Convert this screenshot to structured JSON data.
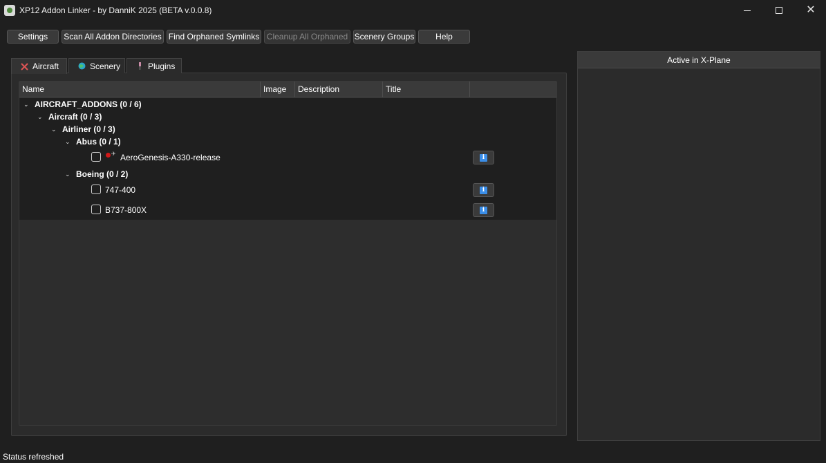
{
  "window": {
    "title": "XP12 Addon Linker - by DanniK 2025 (BETA v.0.0.8)",
    "minimize_icon": "minimize-icon",
    "maximize_icon": "maximize-icon",
    "close_icon": "close-icon",
    "close_glyph": "✕"
  },
  "toolbar": {
    "settings": "Settings",
    "scan": "Scan All Addon Directories",
    "find_orphaned": "Find Orphaned Symlinks",
    "cleanup_orphaned": "Cleanup All Orphaned",
    "scenery_groups": "Scenery Groups",
    "help": "Help"
  },
  "tabs": [
    {
      "label": "Aircraft",
      "icon": "aircraft-icon"
    },
    {
      "label": "Scenery",
      "icon": "globe-icon"
    },
    {
      "label": "Plugins",
      "icon": "plug-icon"
    }
  ],
  "tree": {
    "columns": [
      "Name",
      "Image",
      "Description",
      "Title",
      ""
    ],
    "chevron": "⌄",
    "root": "AIRCRAFT_ADDONS (0 / 6)",
    "aircraft": "Aircraft (0 / 3)",
    "airliner": "Airliner (0 / 3)",
    "abus": "Abus (0 / 1)",
    "boeing": "Boeing (0 / 2)",
    "items": [
      {
        "name": "AeroGenesis-A330-release",
        "checked": false,
        "status": "red-dot"
      },
      {
        "name": "747-400",
        "checked": false
      },
      {
        "name": "B737-800X",
        "checked": false
      }
    ],
    "info_glyph": "i"
  },
  "right_panel": {
    "title": "Active in X-Plane"
  },
  "status": {
    "text": "Status refreshed"
  },
  "colors": {
    "background": "#1f1f1f",
    "panel": "#2b2b2b",
    "info_blue": "#3b8ee8",
    "status_red": "#d01818"
  }
}
